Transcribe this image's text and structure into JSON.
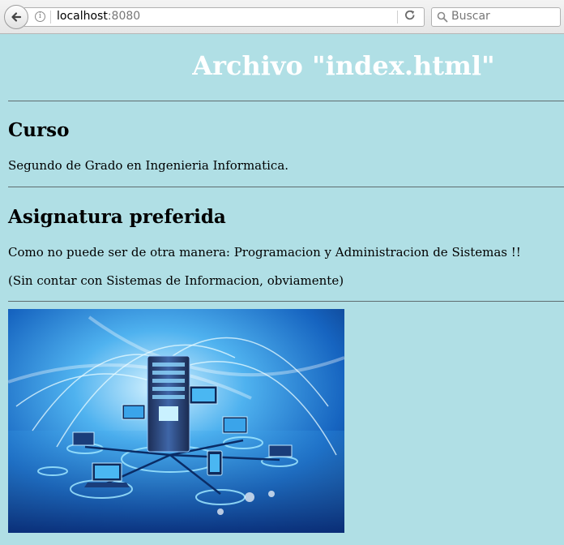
{
  "browser": {
    "url_host": "localhost",
    "url_port": ":8080",
    "search_placeholder": "Buscar"
  },
  "page": {
    "title": "Archivo \"index.html\"",
    "sections": [
      {
        "heading": "Curso",
        "paragraphs": [
          "Segundo de Grado en Ingenieria Informatica."
        ]
      },
      {
        "heading": "Asignatura preferida",
        "paragraphs": [
          "Como no puede ser de otra manera: Programacion y Administracion de Sistemas !!",
          "(Sin contar con Sistemas de Informacion, obviamente)"
        ]
      }
    ],
    "image": {
      "subject": "network-servers-illustration"
    }
  },
  "colors": {
    "page_background": "#b0dfe5",
    "title_color": "#ffffff"
  }
}
